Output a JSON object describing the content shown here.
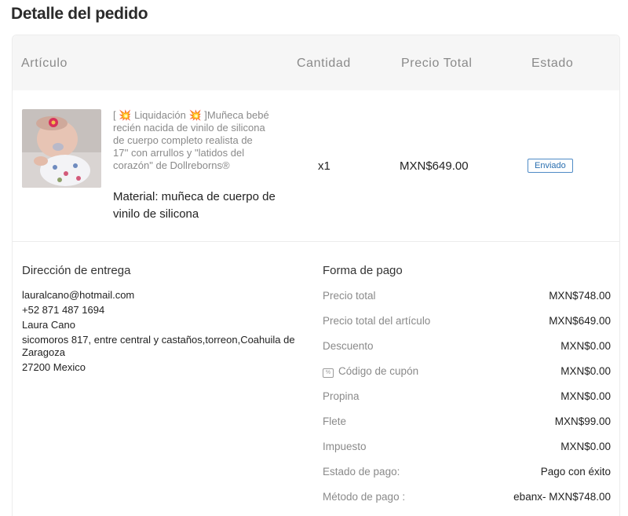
{
  "page_title": "Detalle del pedido",
  "table": {
    "headers": {
      "article": "Artículo",
      "quantity": "Cantidad",
      "total_price": "Precio Total",
      "status": "Estado"
    }
  },
  "item": {
    "image_icon": "doll-photo",
    "name_prefix": "[",
    "liquidation_label": "Liquidación",
    "name_rest": "]Muñeca bebé recién nacida de vinilo de silicona de cuerpo completo realista de 17'' con arrullos y \"latidos del corazón\" de Dollreborns®",
    "spark_icon": "💥",
    "variant": "Material: muñeca de cuerpo de vinilo de silicona",
    "quantity": "x1",
    "price": "MXN$649.00",
    "status": "Enviado"
  },
  "delivery": {
    "title": "Dirección de entrega",
    "email": "lauralcano@hotmail.com",
    "phone": "+52 871 487 1694",
    "name": "Laura  Cano",
    "address": "sicomoros 817, entre central y castaños,torreon,Coahuila de Zaragoza",
    "postal": "27200 Mexico"
  },
  "payment": {
    "title": "Forma de pago",
    "rows": [
      {
        "label": "Precio total",
        "value": "MXN$748.00"
      },
      {
        "label": "Precio total del artículo",
        "value": "MXN$649.00"
      },
      {
        "label": "Descuento",
        "value": "MXN$0.00"
      },
      {
        "label": "Código de cupón",
        "value": "MXN$0.00"
      },
      {
        "label": "Propina",
        "value": "MXN$0.00"
      },
      {
        "label": "Flete",
        "value": "MXN$99.00"
      },
      {
        "label": "Impuesto",
        "value": "MXN$0.00"
      },
      {
        "label": "Estado de pago:",
        "value": "Pago con éxito"
      },
      {
        "label": "Método de pago :",
        "value": "ebanx-  MXN$748.00"
      }
    ],
    "coupon_icon": "coupon-icon"
  }
}
